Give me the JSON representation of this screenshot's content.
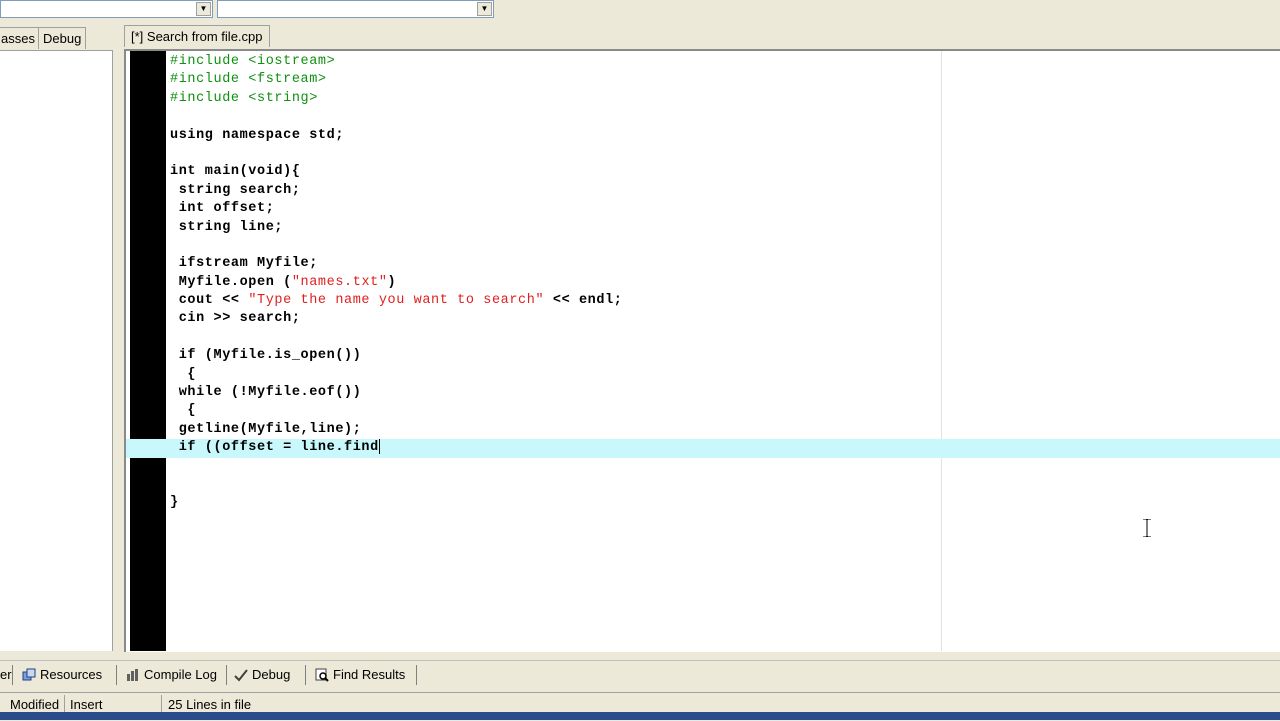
{
  "left_tabs": [
    {
      "label": "asses"
    },
    {
      "label": "Debug"
    }
  ],
  "editor": {
    "tab_label": "[*] Search from file.cpp"
  },
  "code_lines": [
    [
      {
        "t": "#include <iostream>",
        "c": "pp"
      }
    ],
    [
      {
        "t": "#include <fstream>",
        "c": "pp"
      }
    ],
    [
      {
        "t": "#include <string>",
        "c": "pp"
      }
    ],
    [],
    [
      {
        "t": "using namespace std;",
        "c": "kw"
      }
    ],
    [],
    [
      {
        "t": "int main(void){",
        "c": "kw"
      }
    ],
    [
      {
        "t": " string search;",
        "c": "kw"
      }
    ],
    [
      {
        "t": " int offset;",
        "c": "kw"
      }
    ],
    [
      {
        "t": " string line;",
        "c": "kw"
      }
    ],
    [],
    [
      {
        "t": " ifstream Myfile;",
        "c": "kw"
      }
    ],
    [
      {
        "t": " Myfile.open (",
        "c": "kw"
      },
      {
        "t": "\"names.txt\"",
        "c": "str"
      },
      {
        "t": ")",
        "c": "kw"
      }
    ],
    [
      {
        "t": " cout << ",
        "c": "kw"
      },
      {
        "t": "\"Type the name you want to search\"",
        "c": "str"
      },
      {
        "t": " << endl;",
        "c": "kw"
      }
    ],
    [
      {
        "t": " cin >> search;",
        "c": "kw"
      }
    ],
    [],
    [
      {
        "t": " if (Myfile.is_open())",
        "c": "kw"
      }
    ],
    [
      {
        "t": "  {",
        "c": "kw"
      }
    ],
    [
      {
        "t": " while (!Myfile.eof())",
        "c": "kw"
      }
    ],
    [
      {
        "t": "  {",
        "c": "kw"
      }
    ],
    [
      {
        "t": " getline(Myfile,line);",
        "c": "kw"
      }
    ],
    [
      {
        "t": " if ((offset = line.find",
        "c": "kw"
      }
    ],
    [],
    [],
    [
      {
        "t": "}",
        "c": "kw"
      }
    ]
  ],
  "active_line": 21,
  "bottom_tabs": [
    {
      "label": "er",
      "icon": "none"
    },
    {
      "label": "Resources",
      "icon": "resources-icon"
    },
    {
      "label": "Compile Log",
      "icon": "compile-log-icon"
    },
    {
      "label": "Debug",
      "icon": "debug-check-icon"
    },
    {
      "label": "Find Results",
      "icon": "find-results-icon"
    }
  ],
  "status": {
    "modified": "Modified",
    "mode": "Insert",
    "lines": "25 Lines in file"
  },
  "colors": {
    "preprocessor": "#109010",
    "string": "#e02020",
    "active_line": "#c8f8fc",
    "gutter": "#000000"
  }
}
